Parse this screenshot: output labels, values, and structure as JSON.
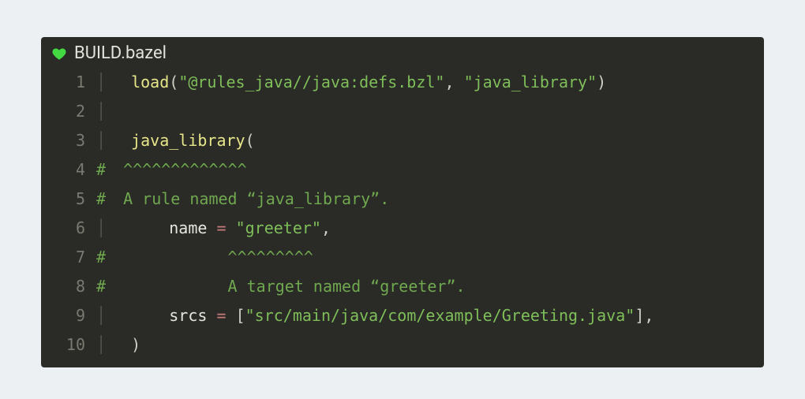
{
  "file": {
    "name": "BUILD.bazel",
    "icon": "heart-icon",
    "icon_color": "#42d942"
  },
  "lines": {
    "l1": {
      "num": "1",
      "gutter": "pipe",
      "tokens": [
        {
          "t": "load",
          "c": "fn"
        },
        {
          "t": "(",
          "c": "p"
        },
        {
          "t": "\"@rules_java//java:defs.bzl\"",
          "c": "s"
        },
        {
          "t": ", ",
          "c": "p"
        },
        {
          "t": "\"java_library\"",
          "c": "s"
        },
        {
          "t": ")",
          "c": "p"
        }
      ]
    },
    "l2": {
      "num": "2",
      "gutter": "pipe",
      "tokens": []
    },
    "l3": {
      "num": "3",
      "gutter": "pipe",
      "tokens": [
        {
          "t": "java_library",
          "c": "fn"
        },
        {
          "t": "(",
          "c": "p"
        }
      ]
    },
    "l4": {
      "num": "4",
      "gutter": "hash",
      "tokens": [
        {
          "t": "^^^^^^^^^^^^^",
          "c": "car"
        }
      ]
    },
    "l5": {
      "num": "5",
      "gutter": "hash",
      "tokens": [
        {
          "t": "A rule named “java_library”.",
          "c": "cm"
        }
      ]
    },
    "l6": {
      "num": "6",
      "gutter": "pipe",
      "tokens": [
        {
          "t": "    ",
          "c": "p"
        },
        {
          "t": "name",
          "c": "id"
        },
        {
          "t": " ",
          "c": "p"
        },
        {
          "t": "=",
          "c": "op"
        },
        {
          "t": " ",
          "c": "p"
        },
        {
          "t": "\"greeter\"",
          "c": "s"
        },
        {
          "t": ",",
          "c": "p"
        }
      ]
    },
    "l7": {
      "num": "7",
      "gutter": "hash",
      "tokens": [
        {
          "t": "           ",
          "c": "cm"
        },
        {
          "t": "^^^^^^^^^",
          "c": "car"
        }
      ]
    },
    "l8": {
      "num": "8",
      "gutter": "hash",
      "tokens": [
        {
          "t": "           A target named “greeter”.",
          "c": "cm"
        }
      ]
    },
    "l9": {
      "num": "9",
      "gutter": "pipe",
      "tokens": [
        {
          "t": "    ",
          "c": "p"
        },
        {
          "t": "srcs",
          "c": "id"
        },
        {
          "t": " ",
          "c": "p"
        },
        {
          "t": "=",
          "c": "op"
        },
        {
          "t": " ",
          "c": "p"
        },
        {
          "t": "[",
          "c": "p"
        },
        {
          "t": "\"src/main/java/com/example/Greeting.java\"",
          "c": "s"
        },
        {
          "t": "]",
          "c": "p"
        },
        {
          "t": ",",
          "c": "p"
        }
      ]
    },
    "l10": {
      "num": "10",
      "gutter": "pipe",
      "tokens": [
        {
          "t": ")",
          "c": "p"
        }
      ]
    }
  },
  "line_order": [
    "l1",
    "l2",
    "l3",
    "l4",
    "l5",
    "l6",
    "l7",
    "l8",
    "l9",
    "l10"
  ]
}
